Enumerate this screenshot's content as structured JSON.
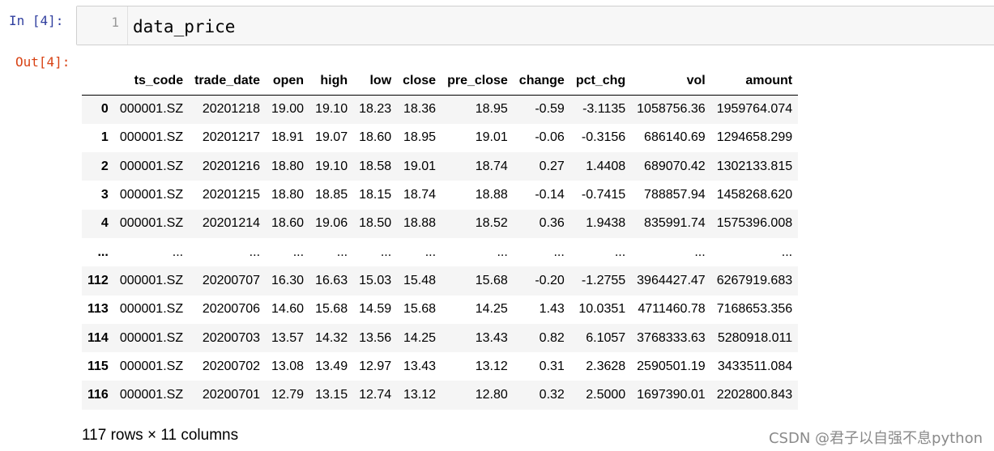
{
  "cell": {
    "in_prompt": "In  [4]:",
    "out_prompt": "Out[4]:",
    "line_number": "1",
    "code": "data_price"
  },
  "table": {
    "columns": [
      "",
      "ts_code",
      "trade_date",
      "open",
      "high",
      "low",
      "close",
      "pre_close",
      "change",
      "pct_chg",
      "vol",
      "amount"
    ],
    "rows": [
      [
        "0",
        "000001.SZ",
        "20201218",
        "19.00",
        "19.10",
        "18.23",
        "18.36",
        "18.95",
        "-0.59",
        "-3.1135",
        "1058756.36",
        "1959764.074"
      ],
      [
        "1",
        "000001.SZ",
        "20201217",
        "18.91",
        "19.07",
        "18.60",
        "18.95",
        "19.01",
        "-0.06",
        "-0.3156",
        "686140.69",
        "1294658.299"
      ],
      [
        "2",
        "000001.SZ",
        "20201216",
        "18.80",
        "19.10",
        "18.58",
        "19.01",
        "18.74",
        "0.27",
        "1.4408",
        "689070.42",
        "1302133.815"
      ],
      [
        "3",
        "000001.SZ",
        "20201215",
        "18.80",
        "18.85",
        "18.15",
        "18.74",
        "18.88",
        "-0.14",
        "-0.7415",
        "788857.94",
        "1458268.620"
      ],
      [
        "4",
        "000001.SZ",
        "20201214",
        "18.60",
        "19.06",
        "18.50",
        "18.88",
        "18.52",
        "0.36",
        "1.9438",
        "835991.74",
        "1575396.008"
      ],
      [
        "...",
        "...",
        "...",
        "...",
        "...",
        "...",
        "...",
        "...",
        "...",
        "...",
        "...",
        "..."
      ],
      [
        "112",
        "000001.SZ",
        "20200707",
        "16.30",
        "16.63",
        "15.03",
        "15.48",
        "15.68",
        "-0.20",
        "-1.2755",
        "3964427.47",
        "6267919.683"
      ],
      [
        "113",
        "000001.SZ",
        "20200706",
        "14.60",
        "15.68",
        "14.59",
        "15.68",
        "14.25",
        "1.43",
        "10.0351",
        "4711460.78",
        "7168653.356"
      ],
      [
        "114",
        "000001.SZ",
        "20200703",
        "13.57",
        "14.32",
        "13.56",
        "14.25",
        "13.43",
        "0.82",
        "6.1057",
        "3768333.63",
        "5280918.011"
      ],
      [
        "115",
        "000001.SZ",
        "20200702",
        "13.08",
        "13.49",
        "12.97",
        "13.43",
        "13.12",
        "0.31",
        "2.3628",
        "2590501.19",
        "3433511.084"
      ],
      [
        "116",
        "000001.SZ",
        "20200701",
        "12.79",
        "13.15",
        "12.74",
        "13.12",
        "12.80",
        "0.32",
        "2.5000",
        "1697390.01",
        "2202800.843"
      ]
    ]
  },
  "footer": {
    "shape": "117 rows × 11 columns"
  },
  "watermark": "CSDN @君子以自强不息python",
  "colors": {
    "in_prompt": "#303f9f",
    "out_prompt": "#d84315",
    "stripe": "#f5f5f5",
    "input_bg": "#f7f7f7"
  }
}
